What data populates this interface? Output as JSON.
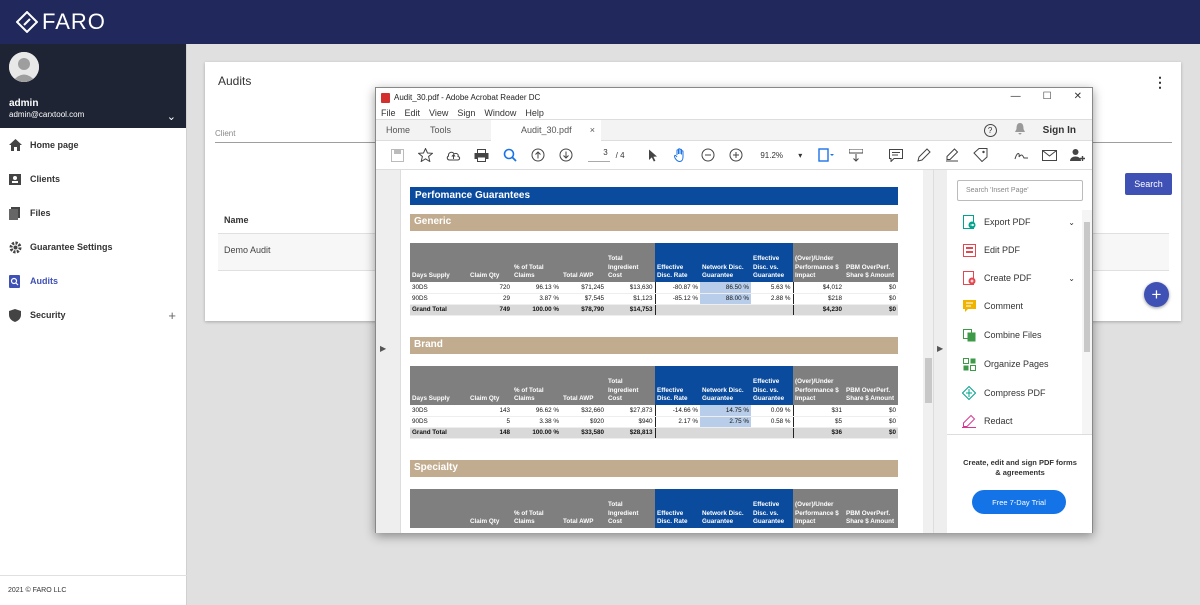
{
  "app": {
    "logo_text": "FARO",
    "brand_color": "#21295c",
    "accent": "#3f51b5"
  },
  "user": {
    "name": "admin",
    "email": "admin@carxtool.com"
  },
  "sidebar": {
    "items": [
      {
        "label": "Home page",
        "icon": "home-icon"
      },
      {
        "label": "Clients",
        "icon": "contacts-icon"
      },
      {
        "label": "Files",
        "icon": "files-icon"
      },
      {
        "label": "Guarantee Settings",
        "icon": "gear-icon"
      },
      {
        "label": "Audits",
        "icon": "audit-icon",
        "active": true
      },
      {
        "label": "Security",
        "icon": "shield-icon",
        "expand": "+"
      }
    ],
    "footer": "2021 © FARO LLC"
  },
  "audits": {
    "title": "Audits",
    "client_label": "Client",
    "search_label": "Search",
    "column_name": "Name",
    "rows": [
      "Demo Audit"
    ],
    "fab": "+"
  },
  "acrobat": {
    "window_title": "Audit_30.pdf - Adobe Acrobat Reader DC",
    "menu": [
      "File",
      "Edit",
      "View",
      "Sign",
      "Window",
      "Help"
    ],
    "tabs": {
      "home": "Home",
      "tools": "Tools",
      "doc": "Audit_30.pdf",
      "close": "×"
    },
    "help": "?",
    "signin": "Sign In",
    "page_current": "3",
    "page_total": "/ 4",
    "zoom": "91.2%",
    "search_placeholder": "Search 'Insert Page'",
    "tools": [
      {
        "label": "Export PDF",
        "icon": "export-pdf-icon",
        "color": "#00a38d",
        "expand": true
      },
      {
        "label": "Edit PDF",
        "icon": "edit-pdf-icon",
        "color": "#e34850",
        "expand": false
      },
      {
        "label": "Create PDF",
        "icon": "create-pdf-icon",
        "color": "#e34850",
        "expand": true
      },
      {
        "label": "Comment",
        "icon": "comment-icon",
        "color": "#f0b400",
        "expand": false
      },
      {
        "label": "Combine Files",
        "icon": "combine-files-icon",
        "color": "#3d9a46",
        "expand": false
      },
      {
        "label": "Organize Pages",
        "icon": "organize-pages-icon",
        "color": "#3d9a46",
        "expand": false
      },
      {
        "label": "Compress PDF",
        "icon": "compress-pdf-icon",
        "color": "#00a38d",
        "expand": false
      },
      {
        "label": "Redact",
        "icon": "redact-icon",
        "color": "#d83790",
        "expand": false
      }
    ],
    "promo": "Create, edit and sign PDF forms & agreements",
    "trial": "Free 7-Day Trial"
  },
  "report": {
    "title": "Perfomance Guarantees",
    "headers": [
      "Days Supply",
      "Claim Qty",
      "% of Total Claims",
      "Total AWP",
      "Total Ingredient Cost",
      "Effective Disc. Rate",
      "Network Disc. Guarantee",
      "Effective Disc. vs. Guarantee",
      "(Over)/Under Performance $ Impact",
      "PBM OverPerf. Share $ Amount"
    ],
    "sections": [
      {
        "name": "Generic",
        "rows": [
          [
            "30DS",
            "720",
            "96.13 %",
            "$71,245",
            "$13,630",
            "-80.87 %",
            "86.50 %",
            "5.63 %",
            "$4,012",
            "$0"
          ],
          [
            "90DS",
            "29",
            "3.87 %",
            "$7,545",
            "$1,123",
            "-85.12 %",
            "88.00 %",
            "2.88 %",
            "$218",
            "$0"
          ]
        ],
        "total": [
          "Grand Total",
          "749",
          "100.00 %",
          "$78,790",
          "$14,753",
          "",
          "",
          "",
          "$4,230",
          "$0"
        ]
      },
      {
        "name": "Brand",
        "rows": [
          [
            "30DS",
            "143",
            "96.62 %",
            "$32,660",
            "$27,873",
            "-14.66 %",
            "14.75 %",
            "0.09 %",
            "$31",
            "$0"
          ],
          [
            "90DS",
            "5",
            "3.38 %",
            "$920",
            "$940",
            "2.17 %",
            "2.75 %",
            "0.58 %",
            "$5",
            "$0"
          ]
        ],
        "total": [
          "Grand Total",
          "148",
          "100.00 %",
          "$33,580",
          "$28,813",
          "",
          "",
          "",
          "$36",
          "$0"
        ]
      },
      {
        "name": "Specialty",
        "rows": [],
        "total": null
      }
    ]
  }
}
